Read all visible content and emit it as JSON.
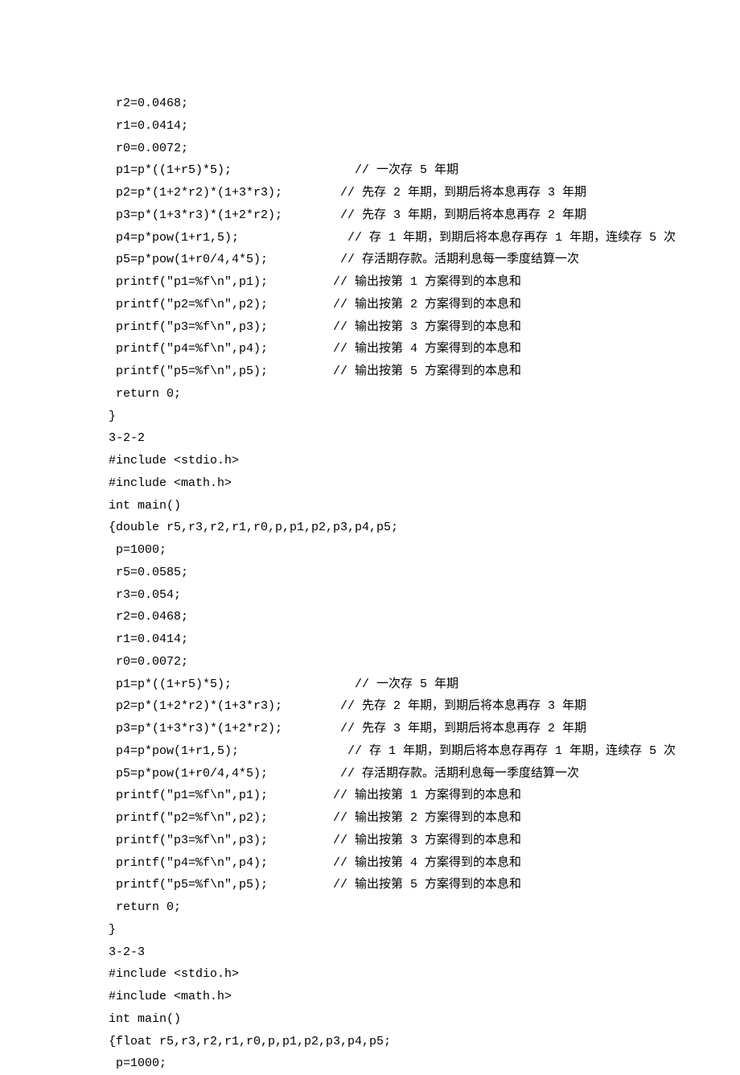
{
  "lines": [
    " r2=0.0468;",
    " r1=0.0414;",
    " r0=0.0072;",
    " p1=p*((1+r5)*5);                 // 一次存 5 年期",
    " p2=p*(1+2*r2)*(1+3*r3);        // 先存 2 年期，到期后将本息再存 3 年期",
    " p3=p*(1+3*r3)*(1+2*r2);        // 先存 3 年期，到期后将本息再存 2 年期",
    " p4=p*pow(1+r1,5);               // 存 1 年期，到期后将本息存再存 1 年期，连续存 5 次",
    " p5=p*pow(1+r0/4,4*5);          // 存活期存款。活期利息每一季度结算一次",
    " printf(\"p1=%f\\n\",p1);         // 输出按第 1 方案得到的本息和",
    " printf(\"p2=%f\\n\",p2);         // 输出按第 2 方案得到的本息和",
    " printf(\"p3=%f\\n\",p3);         // 输出按第 3 方案得到的本息和",
    " printf(\"p4=%f\\n\",p4);         // 输出按第 4 方案得到的本息和",
    " printf(\"p5=%f\\n\",p5);         // 输出按第 5 方案得到的本息和",
    " return 0;",
    "}",
    "3-2-2",
    "#include <stdio.h>",
    "#include <math.h>",
    "int main()",
    "{double r5,r3,r2,r1,r0,p,p1,p2,p3,p4,p5;",
    " p=1000;",
    " r5=0.0585;",
    " r3=0.054;",
    " r2=0.0468;",
    " r1=0.0414;",
    " r0=0.0072;",
    " p1=p*((1+r5)*5);                 // 一次存 5 年期",
    " p2=p*(1+2*r2)*(1+3*r3);        // 先存 2 年期，到期后将本息再存 3 年期",
    " p3=p*(1+3*r3)*(1+2*r2);        // 先存 3 年期，到期后将本息再存 2 年期",
    " p4=p*pow(1+r1,5);               // 存 1 年期，到期后将本息存再存 1 年期，连续存 5 次",
    " p5=p*pow(1+r0/4,4*5);          // 存活期存款。活期利息每一季度结算一次",
    " printf(\"p1=%f\\n\",p1);         // 输出按第 1 方案得到的本息和",
    " printf(\"p2=%f\\n\",p2);         // 输出按第 2 方案得到的本息和",
    " printf(\"p3=%f\\n\",p3);         // 输出按第 3 方案得到的本息和",
    " printf(\"p4=%f\\n\",p4);         // 输出按第 4 方案得到的本息和",
    " printf(\"p5=%f\\n\",p5);         // 输出按第 5 方案得到的本息和",
    " return 0;",
    "}",
    "3-2-3",
    "#include <stdio.h>",
    "#include <math.h>",
    "int main()",
    "{float r5,r3,r2,r1,r0,p,p1,p2,p3,p4,p5;",
    " p=1000;"
  ]
}
